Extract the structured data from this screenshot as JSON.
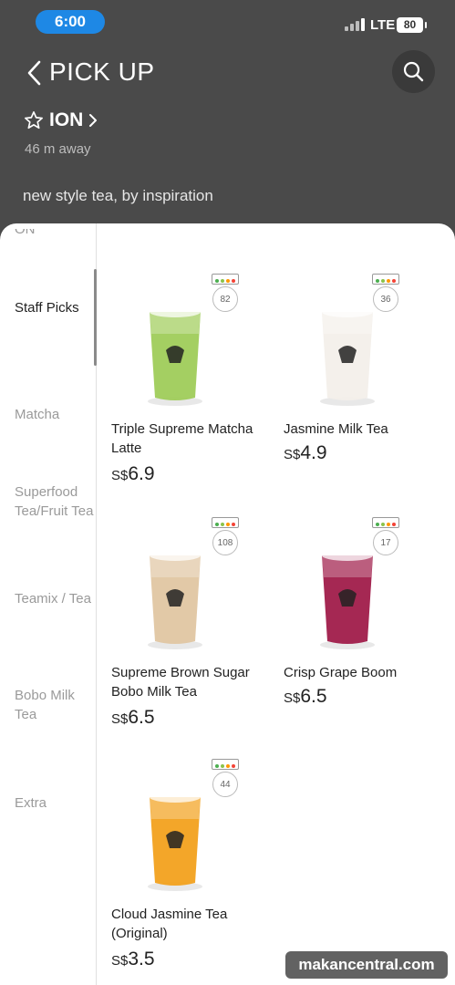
{
  "status_bar": {
    "time": "6:00",
    "network": "LTE",
    "battery": "80"
  },
  "header": {
    "title": "PICK UP",
    "store_name": "ION",
    "distance": "46 m away",
    "tagline": "new style tea, by inspiration"
  },
  "sidebar": {
    "items": [
      {
        "label": "Staff Picks"
      },
      {
        "label": "Matcha"
      },
      {
        "label": "Superfood Tea/Fruit Tea"
      },
      {
        "label": "Teamix / Tea"
      },
      {
        "label": "Bobo Milk Tea"
      },
      {
        "label": "Extra"
      }
    ],
    "cut_item_label": "ON"
  },
  "products": [
    {
      "name": "Triple Supreme Matcha Latte",
      "currency": "S$",
      "price": "6.9",
      "calories": "82",
      "drink_color": "#9fcc5a"
    },
    {
      "name": "Jasmine Milk Tea",
      "currency": "S$",
      "price": "4.9",
      "calories": "36",
      "drink_color": "#f3efea"
    },
    {
      "name": "Supreme Brown Sugar Bobo Milk Tea",
      "currency": "S$",
      "price": "6.5",
      "calories": "108",
      "drink_color": "#e0c6a2"
    },
    {
      "name": "Crisp Grape Boom",
      "currency": "S$",
      "price": "6.5",
      "calories": "17",
      "drink_color": "#a01c4a"
    },
    {
      "name": "Cloud Jasmine Tea (Original)",
      "currency": "S$",
      "price": "3.5",
      "calories": "44",
      "drink_color": "#f2a11e"
    }
  ],
  "watermark": "makancentral.com",
  "colors": {
    "header_bg": "#4a4a4a",
    "time_pill": "#1e88e5"
  }
}
